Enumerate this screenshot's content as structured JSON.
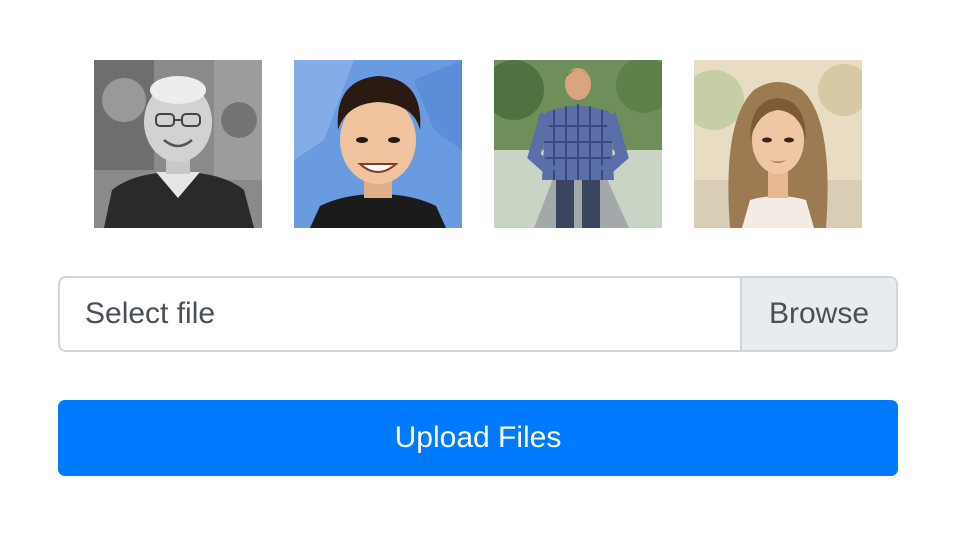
{
  "thumbnails": [
    {
      "name": "elderly-man-portrait",
      "tone": "grayscale"
    },
    {
      "name": "young-man-blue-background",
      "tone": "blue"
    },
    {
      "name": "man-plaid-shirt-road",
      "tone": "green"
    },
    {
      "name": "woman-long-hair-outdoors",
      "tone": "beige"
    }
  ],
  "file_input": {
    "label": "Select file",
    "browse_label": "Browse"
  },
  "upload": {
    "label": "Upload Files"
  },
  "colors": {
    "primary": "#007bff",
    "input_border": "#ced4da",
    "browse_bg": "#e9ecef",
    "text": "#495057"
  }
}
